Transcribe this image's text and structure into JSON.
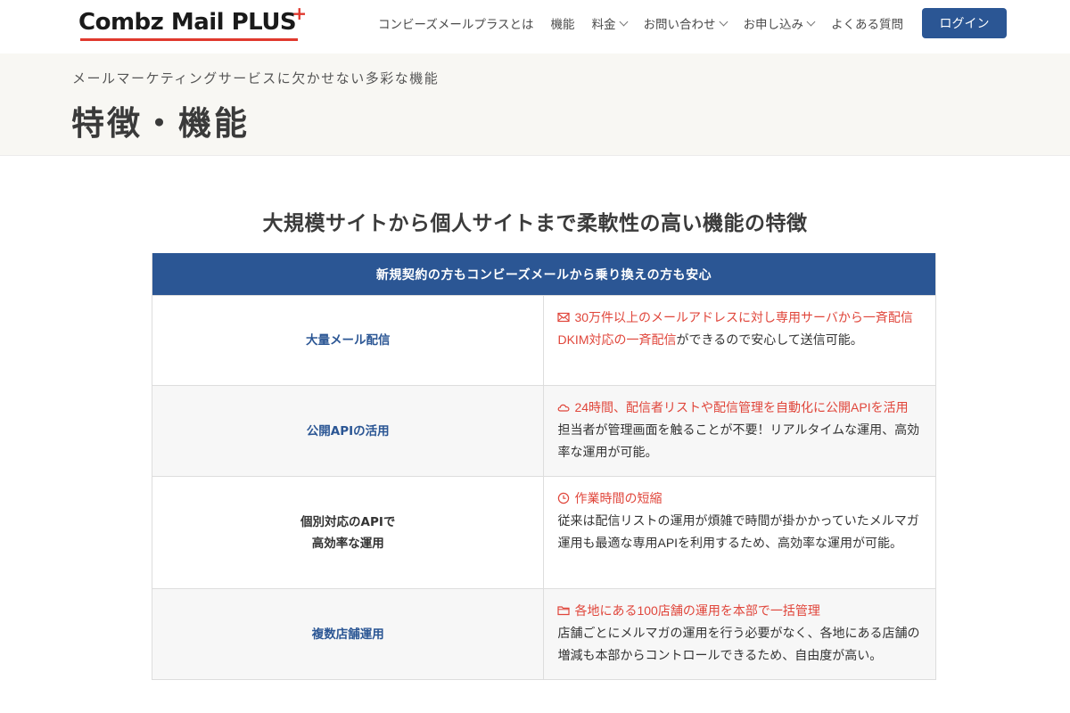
{
  "header": {
    "logo_text": "Combz Mail PLUS",
    "logo_plus": "+",
    "nav": [
      {
        "label": "コンビーズメールプラスとは",
        "dropdown": false
      },
      {
        "label": "機能",
        "dropdown": false
      },
      {
        "label": "料金",
        "dropdown": true
      },
      {
        "label": "お問い合わせ",
        "dropdown": true
      },
      {
        "label": "お申し込み",
        "dropdown": true
      },
      {
        "label": "よくある質問",
        "dropdown": false
      }
    ],
    "login_label": "ログイン"
  },
  "hero": {
    "subtitle": "メールマーケティングサービスに欠かせない多彩な機能",
    "title": "特徴・機能"
  },
  "section": {
    "title": "大規模サイトから個人サイトまで柔軟性の高い機能の特徴",
    "table_header": "新規契約の方もコンビーズメールから乗り換えの方も安心",
    "rows": [
      {
        "label_line1": "大量メール配信",
        "label_line2": "",
        "icon": "envelope-icon",
        "highlight": "30万件以上のメールアドレスに対し専用サーバから一斉配信",
        "highlight2": "DKIM対応の一斉配信",
        "body": "ができるので安心して送信可能。"
      },
      {
        "label_line1": "公開APIの活用",
        "label_line2": "",
        "icon": "cloud-icon",
        "highlight": "24時間、配信者リストや配信管理を自動化に公開APIを活用",
        "highlight2": "",
        "body": "担当者が管理画面を触ることが不要！リアルタイムな運用、高効率な運用が可能。"
      },
      {
        "label_line1": "個別対応のAPIで",
        "label_line2": "高効率な運用",
        "icon": "clock-icon",
        "highlight": "作業時間の短縮",
        "highlight2": "",
        "body": "従来は配信リストの運用が煩雑で時間が掛かかっていたメルマガ運用も最適な専用APIを利用するため、高効率な運用が可能。"
      },
      {
        "label_line1": "複数店舗運用",
        "label_line2": "",
        "icon": "folder-icon",
        "highlight": "各地にある100店舗の運用を本部で一括管理",
        "highlight2": "",
        "body": "店舗ごとにメルマガの運用を行う必要がなく、各地にある店舗の増減も本部からコントロールできるため、自由度が高い。"
      }
    ]
  },
  "colors": {
    "brand_blue": "#2b5694",
    "accent_red": "#e0463b",
    "hero_bg": "#f8f7f3"
  }
}
